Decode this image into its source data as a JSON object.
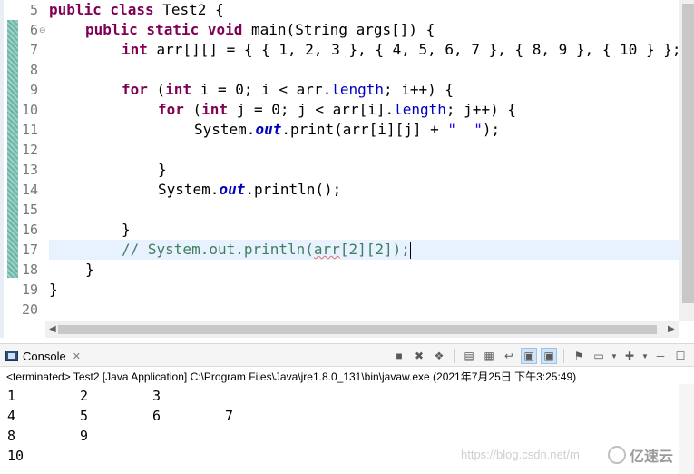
{
  "editor": {
    "line_numbers": [
      "5",
      "6",
      "7",
      "8",
      "9",
      "10",
      "11",
      "12",
      "13",
      "14",
      "15",
      "16",
      "17",
      "18",
      "19",
      "20"
    ],
    "fold_marker_line": "6",
    "code": {
      "l5": {
        "kw1": "public class",
        "rest": " Test2 {"
      },
      "l6": {
        "kw1": "public static void",
        "rest": " main(String args[]) {"
      },
      "l7": {
        "kw1": "int",
        "rest": " arr[][] = { { 1, 2, 3 }, { 4, 5, 6, 7 }, { 8, 9 }, { 10 } };"
      },
      "l9": {
        "kw1": "for",
        "p1": " (",
        "kw2": "int",
        "p2": " i = 0; i < arr.",
        "fld": "length",
        "p3": "; i++) {"
      },
      "l10": {
        "kw1": "for",
        "p1": " (",
        "kw2": "int",
        "p2": " j = 0; j < arr[i].",
        "fld": "length",
        "p3": "; j++) {"
      },
      "l11": {
        "p1": "System.",
        "sfld": "out",
        "p2": ".print(arr[i][j] + ",
        "str": "\"  \"",
        "p3": ");"
      },
      "l13": {
        "p1": "}"
      },
      "l14": {
        "p1": "System.",
        "sfld": "out",
        "p2": ".println();"
      },
      "l16": {
        "p1": "}"
      },
      "l17": {
        "c1": "// System.out.println(",
        "c2": "arr",
        "c3": "[2][2]);"
      },
      "l18": {
        "p1": "}"
      },
      "l19": {
        "p1": "}"
      }
    }
  },
  "console": {
    "tab_label": "Console",
    "status": "<terminated> Test2 [Java Application] C:\\Program Files\\Java\\jre1.8.0_131\\bin\\javaw.exe (2021年7月25日 下午3:25:49)",
    "output": [
      [
        "1",
        "2",
        "3"
      ],
      [
        "4",
        "5",
        "6",
        "7"
      ],
      [
        "8",
        "9"
      ],
      [
        "10"
      ]
    ]
  },
  "watermark": {
    "url": "https://blog.csdn.net/m",
    "brand": "亿速云"
  }
}
